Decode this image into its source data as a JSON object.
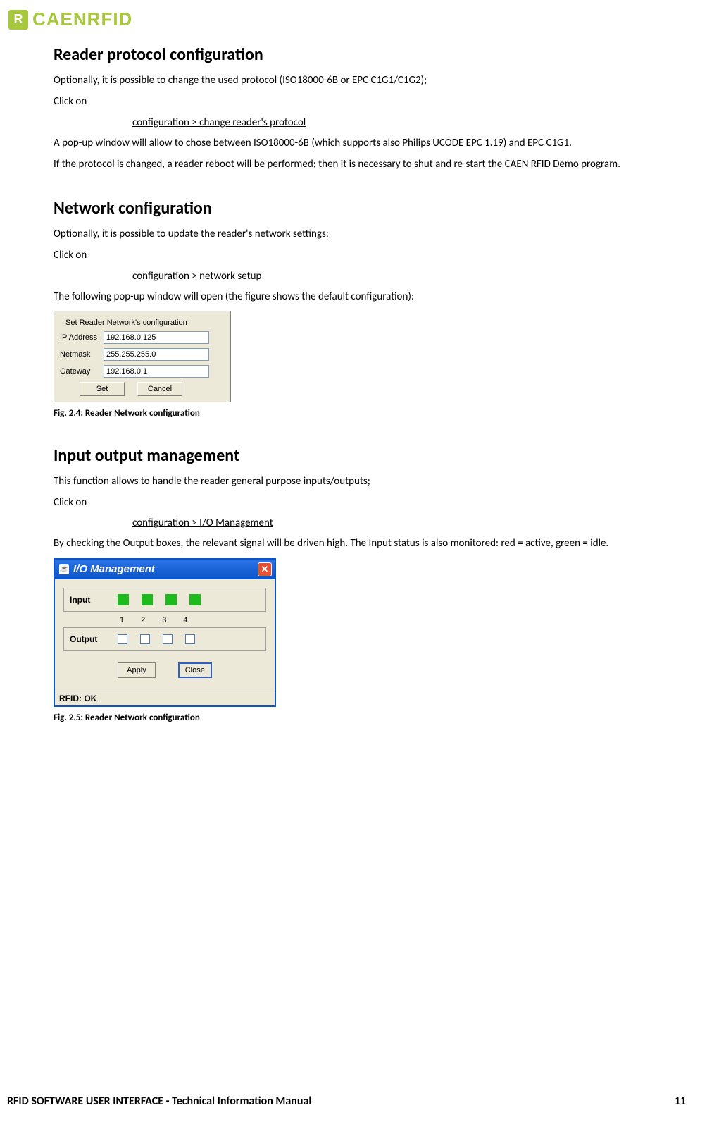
{
  "logo_text": "CAENRFID",
  "section1": {
    "heading": "Reader protocol configuration",
    "p1": "Optionally, it is possible to change the used protocol (ISO18000-6B or EPC C1G1/C1G2);",
    "p2": "Click on",
    "menu": "configuration > change reader's protocol",
    "p3": "A pop-up window will allow to chose between ISO18000-6B (which supports also Philips UCODE EPC 1.19) and EPC C1G1.",
    "p4": "If the protocol is changed, a reader reboot will be performed; then it is necessary to shut and re-start the CAEN RFID Demo program."
  },
  "section2": {
    "heading": "Network configuration",
    "p1": "Optionally, it is possible to update  the reader's network settings;",
    "p2": "Click on",
    "menu": "configuration > network setup",
    "p3": "The following pop-up window will open (the figure shows the default configuration):",
    "dialog": {
      "title": "Set Reader Network's configuration",
      "ip_label": "IP Address",
      "ip_value": "192.168.0.125",
      "mask_label": "Netmask",
      "mask_value": "255.255.255.0",
      "gw_label": "Gateway",
      "gw_value": "192.168.0.1",
      "set_btn": "Set",
      "cancel_btn": "Cancel"
    },
    "caption": "Fig. 2.4: Reader Network configuration"
  },
  "section3": {
    "heading": "Input output management",
    "p1": "This function allows to handle the reader general purpose inputs/outputs;",
    "p2": "Click on",
    "menu": "configuration > I/O Management",
    "p3": "By checking the Output boxes, the relevant signal will be driven high. The Input status is also monitored: red = active, green = idle.",
    "dialog": {
      "title": "I/O Management",
      "input_label": "Input",
      "output_label": "Output",
      "cols": [
        "1",
        "2",
        "3",
        "4"
      ],
      "apply_btn": "Apply",
      "close_btn": "Close",
      "status": "RFID: OK"
    },
    "caption": "Fig. 2.5: Reader Network configuration"
  },
  "footer": {
    "left": "RFID SOFTWARE USER INTERFACE -  Technical Information Manual",
    "page": "11"
  }
}
